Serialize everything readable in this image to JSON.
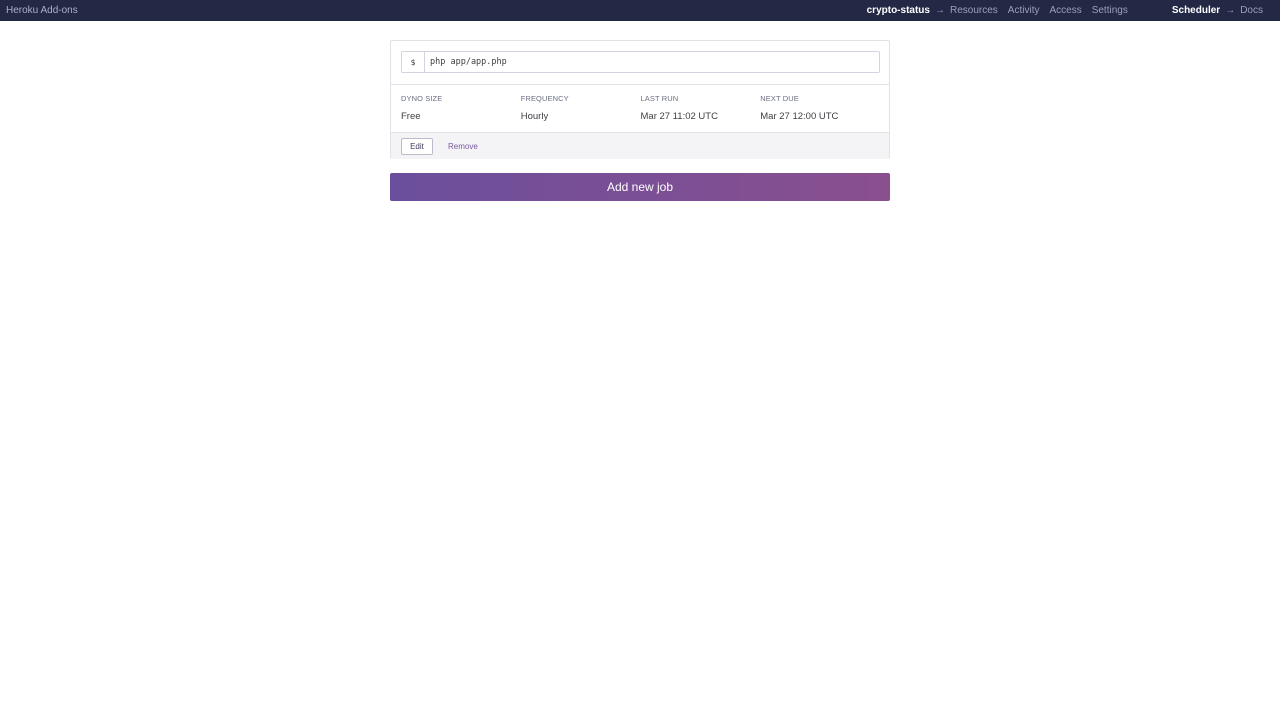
{
  "topbar": {
    "brand": "Heroku Add-ons",
    "app_name": "crypto-status",
    "arrow": "→",
    "links": [
      "Resources",
      "Activity",
      "Access",
      "Settings"
    ],
    "addon_name": "Scheduler",
    "docs_label": "Docs"
  },
  "job": {
    "prompt": "$",
    "command": "php app/app.php",
    "details": [
      {
        "label": "DYNO SIZE",
        "value": "Free"
      },
      {
        "label": "FREQUENCY",
        "value": "Hourly"
      },
      {
        "label": "LAST RUN",
        "value": "Mar 27 11:02 UTC"
      },
      {
        "label": "NEXT DUE",
        "value": "Mar 27 12:00 UTC"
      }
    ],
    "edit_label": "Edit",
    "remove_label": "Remove"
  },
  "add_job_label": "Add new job",
  "colors": {
    "topbar_bg": "#232845",
    "accent_start": "#6b4f9c",
    "accent_end": "#8a4f8e",
    "link": "#79589f"
  }
}
